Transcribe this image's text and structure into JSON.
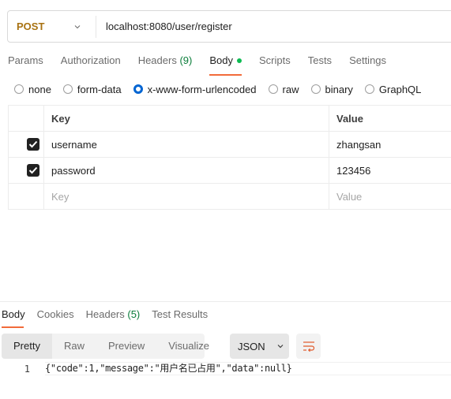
{
  "request": {
    "method": "POST",
    "url": "localhost:8080/user/register",
    "method_color": "#a87212"
  },
  "request_tabs": [
    {
      "label": "Params",
      "active": false
    },
    {
      "label": "Authorization",
      "active": false
    },
    {
      "label": "Headers",
      "count": "(9)",
      "active": false
    },
    {
      "label": "Body",
      "active": true,
      "indicator": "green-dot"
    },
    {
      "label": "Scripts",
      "active": false
    },
    {
      "label": "Tests",
      "active": false
    },
    {
      "label": "Settings",
      "active": false
    }
  ],
  "body_types": [
    {
      "label": "none",
      "selected": false
    },
    {
      "label": "form-data",
      "selected": false
    },
    {
      "label": "x-www-form-urlencoded",
      "selected": true
    },
    {
      "label": "raw",
      "selected": false
    },
    {
      "label": "binary",
      "selected": false
    },
    {
      "label": "GraphQL",
      "selected": false
    }
  ],
  "params_table": {
    "headers": {
      "key": "Key",
      "value": "Value"
    },
    "rows": [
      {
        "checked": true,
        "key": "username",
        "value": "zhangsan"
      },
      {
        "checked": true,
        "key": "password",
        "value": "123456"
      }
    ],
    "placeholder": {
      "key": "Key",
      "value": "Value"
    }
  },
  "response_tabs": [
    {
      "label": "Body",
      "active": true
    },
    {
      "label": "Cookies",
      "active": false
    },
    {
      "label": "Headers",
      "count": "(5)",
      "active": false
    },
    {
      "label": "Test Results",
      "active": false
    }
  ],
  "response_views": [
    {
      "label": "Pretty",
      "active": true
    },
    {
      "label": "Raw",
      "active": false
    },
    {
      "label": "Preview",
      "active": false
    },
    {
      "label": "Visualize",
      "active": false
    }
  ],
  "response_format": "JSON",
  "wrap_icon": "wrap-lines-icon",
  "response_body": {
    "lines": [
      {
        "number": "1",
        "text": "{\"code\":1,\"message\":\"用户名已占用\",\"data\":null}"
      }
    ]
  },
  "colors": {
    "accent_tab": "#f26b3a",
    "body_dot": "#0cbb52",
    "count_green": "#0a7d3a",
    "radio_selected": "#0265d2"
  }
}
